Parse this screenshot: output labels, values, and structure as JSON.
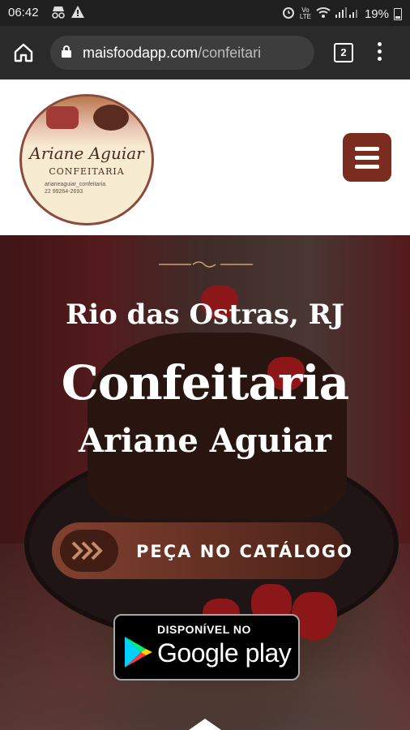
{
  "status_bar": {
    "time": "06:42",
    "battery": "19%",
    "icons": [
      "incognito-icon",
      "warning-icon",
      "alarm-icon",
      "volte-icon",
      "wifi-icon",
      "signal-icon",
      "battery-icon"
    ]
  },
  "browser": {
    "url_domain": "maisfoodapp.com",
    "url_path": "/confeitari",
    "tab_count": "2"
  },
  "site": {
    "logo": {
      "name": "Ariane Aguiar",
      "subtitle": "CONFEITARIA",
      "instagram": "arianeaguiar_confeitaria",
      "phone": "22 99264-2693"
    }
  },
  "hero": {
    "location": "Rio das Ostras, RJ",
    "title_line1": "Confeitaria",
    "title_line2": "Ariane Aguiar",
    "cta_label": "PEÇA NO CATÁLOGO",
    "gplay_small": "DISPONÍVEL NO",
    "gplay_big": "Google play"
  },
  "colors": {
    "brand": "#7a2c1f",
    "statusbar": "#1f1f1f",
    "browser_bar": "#2a2a2a"
  }
}
